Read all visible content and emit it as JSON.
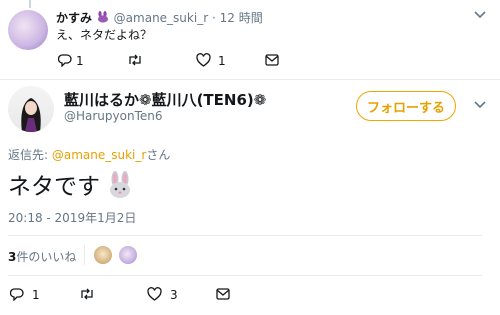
{
  "reply_tweet": {
    "display_name": "かすみ",
    "handle": "@amane_suki_r",
    "separator": "·",
    "time": "12 時間",
    "text": "え、ネタだよね？",
    "actions": {
      "reply_count": "1",
      "retweet_count": "",
      "like_count": "1"
    }
  },
  "main_tweet": {
    "display_name": "藍川はるか❁藍川八(TEN6)❁",
    "handle": "@HarupyonTen6",
    "follow_label": "フォローする",
    "reply_to_prefix": "返信先: ",
    "reply_to_handle": "@amane_suki_r",
    "reply_to_suffix": "さん",
    "text": "ネタです",
    "timestamp": "20:18 - 2019年1月2日",
    "likes_count": "3",
    "likes_label": "件のいいね",
    "actions": {
      "reply_count": "1",
      "retweet_count": "",
      "like_count": "3"
    }
  },
  "colors": {
    "accent": "#E8A000",
    "muted": "#657786",
    "divider": "#e6ecf0"
  },
  "icons": [
    "reply-icon",
    "retweet-icon",
    "like-icon",
    "message-icon",
    "chevron-down-icon",
    "bunny-emoji-icon",
    "purple-bunny-emoji-icon"
  ]
}
